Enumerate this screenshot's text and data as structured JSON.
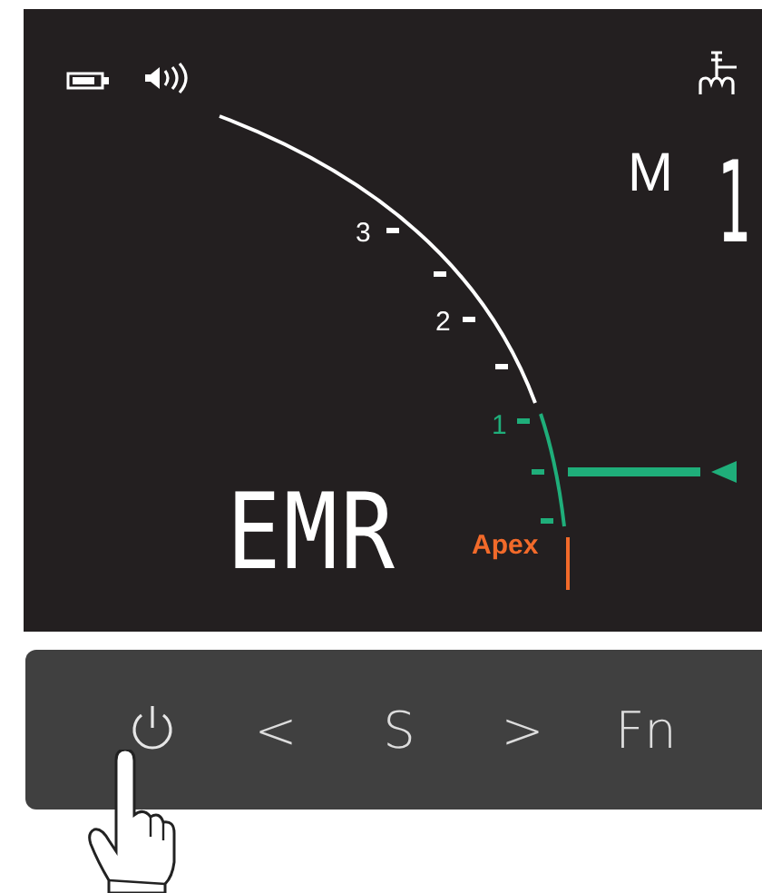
{
  "status": {
    "mode_label": "M",
    "mode_value": "1",
    "function_label": "EMR"
  },
  "scale": {
    "marks": [
      {
        "label": "3",
        "kind": "number"
      },
      {
        "label": "2",
        "kind": "number"
      },
      {
        "label": "1",
        "kind": "number"
      },
      {
        "label": "Apex",
        "kind": "apex"
      }
    ]
  },
  "buttons": [
    {
      "kind": "power",
      "pressed": true
    },
    {
      "kind": "text",
      "label": "<",
      "pressed": false
    },
    {
      "kind": "text",
      "label": "S",
      "pressed": false
    },
    {
      "kind": "text",
      "label": ">",
      "pressed": false
    },
    {
      "kind": "text",
      "label": "Fn",
      "pressed": false
    }
  ]
}
